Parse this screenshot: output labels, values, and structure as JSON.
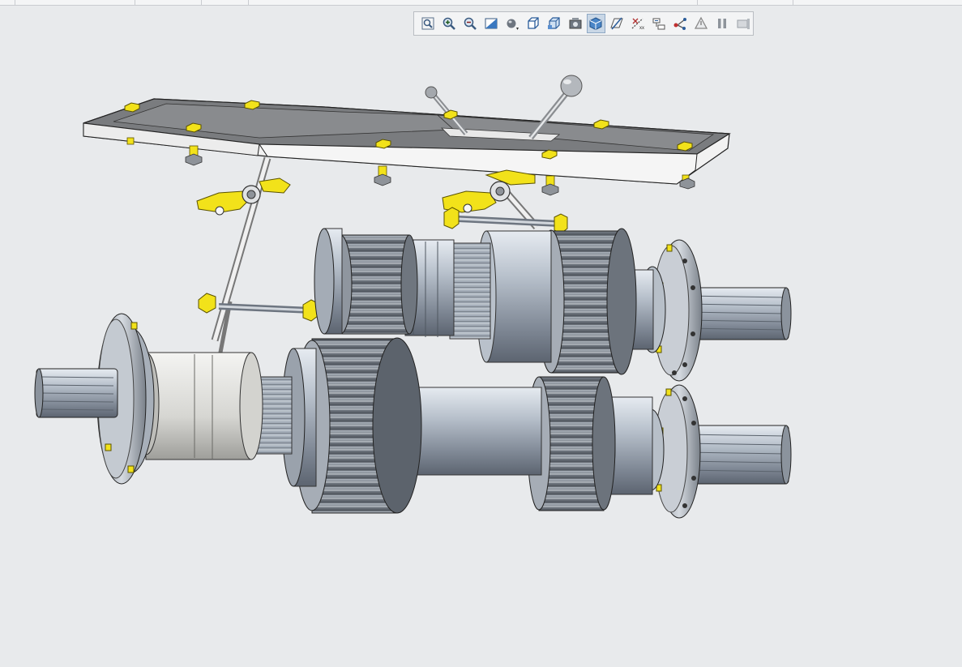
{
  "window": {
    "background": "#e8eaec"
  },
  "toolbar": {
    "buttons": [
      {
        "id": "refit",
        "icon": "refit-icon"
      },
      {
        "id": "zoom-in",
        "icon": "zoom-in-icon"
      },
      {
        "id": "zoom-out",
        "icon": "zoom-out-icon"
      },
      {
        "id": "repaint",
        "icon": "repaint-icon"
      },
      {
        "id": "display-style",
        "icon": "display-style-icon"
      },
      {
        "id": "saved-orientations",
        "icon": "view-cube-icon"
      },
      {
        "id": "view-manager",
        "icon": "view-manager-icon"
      },
      {
        "id": "perspective",
        "icon": "camera-icon"
      },
      {
        "id": "datum-display",
        "icon": "shaded-cube-icon",
        "active": true
      },
      {
        "id": "plane-display",
        "icon": "plane-icon"
      },
      {
        "id": "axis-display",
        "icon": "axis-icon"
      },
      {
        "id": "point-display",
        "icon": "point-icon"
      },
      {
        "id": "csys-display",
        "icon": "csys-icon"
      },
      {
        "id": "annotation",
        "icon": "annotation-icon"
      },
      {
        "id": "pause",
        "icon": "pause-icon"
      },
      {
        "id": "redraw",
        "icon": "redraw-icon"
      }
    ]
  },
  "model": {
    "name": "gearbox-assembly",
    "colors": {
      "steel": "#a9b2be",
      "gear": "#7c838c",
      "plate": "#8a8c8f",
      "bolt": "#f2e21a",
      "sleeve": "#e3e3e0"
    }
  }
}
